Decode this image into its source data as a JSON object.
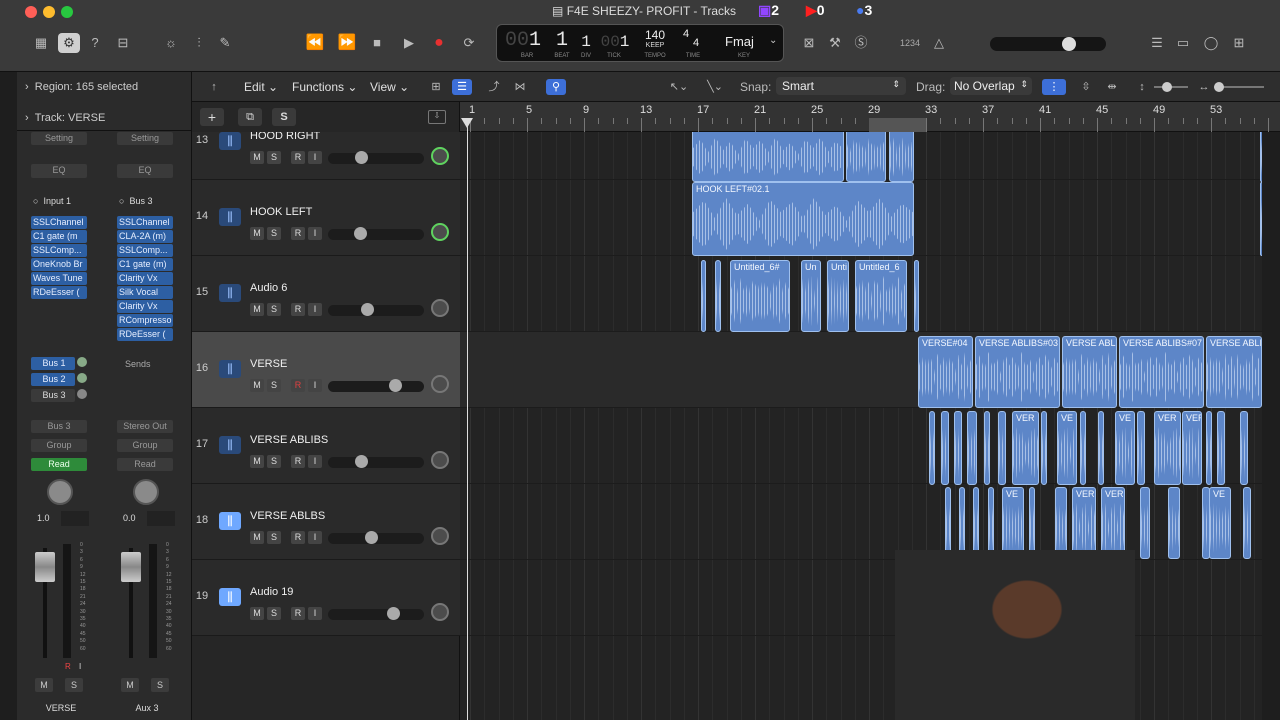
{
  "window": {
    "title": "F4E SHEEZY- PROFIT - Tracks"
  },
  "social": {
    "twitch": "2",
    "youtube": "0",
    "facebook": "3"
  },
  "lcd": {
    "bar": "1",
    "beat": "1",
    "div": "1",
    "tick": "1",
    "bar_lbl": "BAR",
    "beat_lbl": "BEAT",
    "div_lbl": "DIV",
    "tick_lbl": "TICK",
    "tempo": "140",
    "keep": "KEEP",
    "tempo_lbl": "TEMPO",
    "sig_top": "4",
    "sig_bottom": "4",
    "time_lbl": "TIME",
    "key": "Fmaj",
    "key_lbl": "KEY"
  },
  "top_right": {
    "count_in": "1234"
  },
  "inspector": {
    "region": "Region: 165 selected",
    "track": "Track: VERSE",
    "strip1": {
      "setting": "Setting",
      "eq": "EQ",
      "input": "Input 1",
      "plugins": [
        "SSLChannel",
        "C1 gate (m",
        "SSLComp...",
        "OneKnob Br",
        "Waves Tune",
        "RDeEsser ("
      ],
      "sends": [
        "Bus 1",
        "Bus 2",
        "Bus 3"
      ],
      "output": "Bus 3",
      "group": "Group",
      "auto": "Read",
      "value": "1.0",
      "m": "M",
      "s": "S",
      "r": "R",
      "i": "I",
      "name": "VERSE"
    },
    "strip2": {
      "setting": "Setting",
      "eq": "EQ",
      "input": "Bus 3",
      "plugins": [
        "SSLChannel",
        "CLA-2A (m)",
        "SSLComp...",
        "C1 gate (m)",
        "Clarity Vx",
        "Silk Vocal",
        "Clarity Vx",
        "RCompresso",
        "RDeEsser ("
      ],
      "sends": "Sends",
      "output": "Stereo Out",
      "group": "Group",
      "auto": "Read",
      "value": "0.0",
      "m": "M",
      "s": "S",
      "name": "Aux 3"
    },
    "meter_scale": [
      "0",
      "3",
      "6",
      "9",
      "12",
      "15",
      "18",
      "21",
      "24",
      "30",
      "35",
      "40",
      "45",
      "50",
      "60"
    ]
  },
  "toolbar": {
    "edit": "Edit",
    "functions": "Functions",
    "view": "View",
    "snap_label": "Snap:",
    "snap_value": "Smart",
    "drag_label": "Drag:",
    "drag_value": "No Overlap",
    "add": "+",
    "s": "S"
  },
  "ruler": [
    "1",
    "5",
    "9",
    "13",
    "17",
    "21",
    "25",
    "29",
    "33",
    "37",
    "41",
    "45",
    "49",
    "53"
  ],
  "tracks": [
    {
      "num": "13",
      "name": "HOOD RIGHT",
      "m": "M",
      "s": "S",
      "r": "R",
      "i": "I",
      "vol": 0.33,
      "pan_green": true
    },
    {
      "num": "14",
      "name": "HOOK LEFT",
      "m": "M",
      "s": "S",
      "r": "R",
      "i": "I",
      "vol": 0.31,
      "pan_green": true
    },
    {
      "num": "15",
      "name": "Audio 6",
      "m": "M",
      "s": "S",
      "r": "R",
      "i": "I",
      "vol": 0.4,
      "pan_green": false
    },
    {
      "num": "16",
      "name": "VERSE",
      "m": "M",
      "s": "S",
      "r": "R",
      "i": "I",
      "vol": 0.74,
      "pan_green": false
    },
    {
      "num": "17",
      "name": "VERSE ABLIBS",
      "m": "M",
      "s": "S",
      "r": "R",
      "i": "I",
      "vol": 0.32,
      "pan_green": false
    },
    {
      "num": "18",
      "name": "VERSE ABLBS",
      "m": "M",
      "s": "S",
      "r": "R",
      "i": "I",
      "vol": 0.45,
      "pan_green": false
    },
    {
      "num": "19",
      "name": "Audio 19",
      "m": "M",
      "s": "S",
      "r": "R",
      "i": "I",
      "vol": 0.71,
      "pan_green": false
    }
  ],
  "regions": {
    "hook_left": "HOOK LEFT#02.1",
    "audio6": [
      "Untitled_6#",
      "Un",
      "Unti",
      "Untitled_6"
    ],
    "verse": [
      "VERSE#04",
      "VERSE ABLIBS#03",
      "VERSE ABLI",
      "VERSE ABLIBS#07",
      "VERSE ABLI"
    ],
    "ablibs": [
      "VER",
      "VE",
      "VE",
      "VER",
      "VER"
    ],
    "ablbs": [
      "VE",
      "VER",
      "VER",
      "VE"
    ]
  },
  "colors": {
    "accent": "#3d6fd8",
    "region": "#5d86c8",
    "read": "#2e8b3a",
    "plugin": "#2d5fa3"
  }
}
